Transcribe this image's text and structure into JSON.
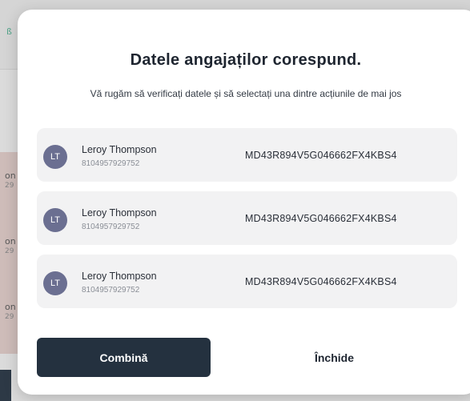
{
  "background": {
    "accent_glyph": "ß",
    "rows": [
      {
        "name": "on",
        "sub": "29"
      },
      {
        "name": "on",
        "sub": "29"
      },
      {
        "name": "on",
        "sub": "29"
      }
    ]
  },
  "modal": {
    "title": "Datele angajaților corespund.",
    "subtitle": "Vă rugăm să verificați datele și să selectați una dintre acțiunile de mai jos",
    "employees": [
      {
        "initials": "LT",
        "name": "Leroy Thompson",
        "phone": "8104957929752",
        "iban": "MD43R894V5G046662FX4KBS4"
      },
      {
        "initials": "LT",
        "name": "Leroy Thompson",
        "phone": "8104957929752",
        "iban": "MD43R894V5G046662FX4KBS4"
      },
      {
        "initials": "LT",
        "name": "Leroy Thompson",
        "phone": "8104957929752",
        "iban": "MD43R894V5G046662FX4KBS4"
      }
    ],
    "primary_button": "Combină",
    "secondary_button": "Închide"
  },
  "colors": {
    "primary": "#24313f",
    "avatar": "#6b6f91",
    "card_bg": "#f2f2f3"
  }
}
